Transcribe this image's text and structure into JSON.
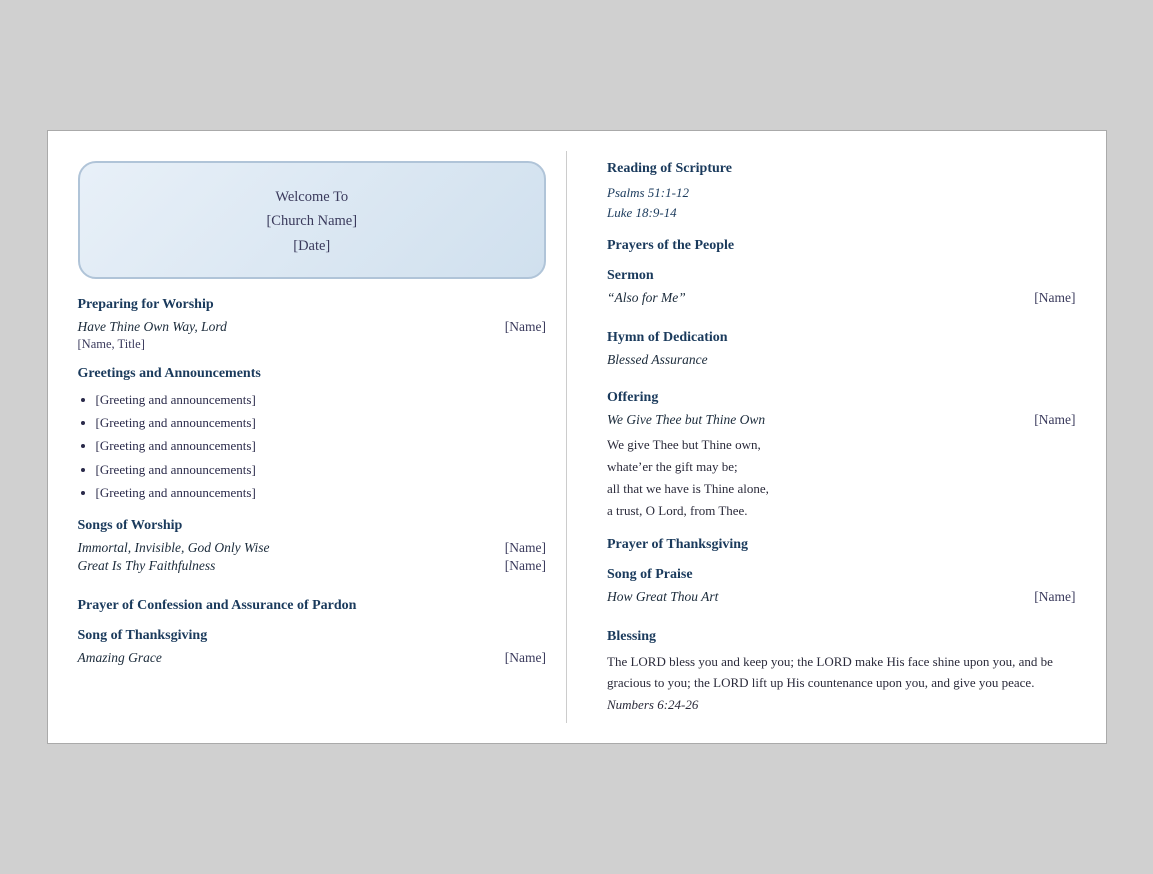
{
  "welcome": {
    "line1": "Welcome To",
    "line2": "[Church Name]",
    "line3": "[Date]"
  },
  "left": {
    "preparing": {
      "header": "Preparing for Worship",
      "song": "Have Thine Own Way, Lord",
      "name": "[Name]",
      "sublabel": "[Name, Title]"
    },
    "greetings": {
      "header": "Greetings and Announcements",
      "items": [
        "[Greeting and announcements]",
        "[Greeting and announcements]",
        "[Greeting and announcements]",
        "[Greeting and announcements]",
        "[Greeting and announcements]"
      ]
    },
    "songs": {
      "header": "Songs of Worship",
      "song1": "Immortal, Invisible, God Only Wise",
      "name1": "[Name]",
      "song2": "Great Is Thy Faithfulness",
      "name2": "[Name]"
    },
    "confession": {
      "header": "Prayer of Confession and Assurance of Pardon"
    },
    "thanksgiving": {
      "header": "Song of Thanksgiving",
      "song": "Amazing Grace",
      "name": "[Name]"
    }
  },
  "right": {
    "scripture": {
      "header": "Reading of Scripture",
      "ref1": "Psalms 51:1-12",
      "ref2": "Luke 18:9-14"
    },
    "prayers": {
      "header": "Prayers of the People"
    },
    "sermon": {
      "header": "Sermon",
      "title": "“Also for Me”",
      "name": "[Name]"
    },
    "hymn": {
      "header": "Hymn of Dedication",
      "song": "Blessed Assurance"
    },
    "offering": {
      "header": "Offering",
      "song": "We Give Thee but Thine Own",
      "name": "[Name]",
      "verse1": "We give Thee but Thine own,",
      "verse2": "whate’er the gift may be;",
      "verse3": "all that we have is Thine alone,",
      "verse4": "a trust, O Lord, from Thee."
    },
    "prayer_thanks": {
      "header": "Prayer of Thanksgiving"
    },
    "song_praise": {
      "header": "Song of Praise",
      "song": "How Great Thou Art",
      "name": "[Name]"
    },
    "blessing": {
      "header": "Blessing",
      "text": "The LORD bless you and keep you; the LORD make His face shine upon you, and be gracious to you; the LORD lift up His countenance upon you, and give you peace.",
      "ref": "Numbers 6:24-26"
    }
  }
}
